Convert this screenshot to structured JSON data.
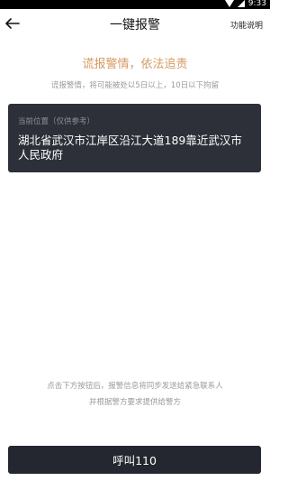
{
  "status_bar": {
    "time": "9:33"
  },
  "header": {
    "title": "一键报警",
    "help_label": "功能说明"
  },
  "warning": {
    "title": "谎报警情，依法追责",
    "subtitle": "谎报警情，将可能被处以5日以上，10日以下拘留"
  },
  "location": {
    "label": "当前位置（仅供参考）",
    "address": "湖北省武汉市江岸区沿江大道189靠近武汉市人民政府"
  },
  "notice": {
    "line1": "点击下方按钮后，报警信息将同步发送给紧急联系人",
    "line2": "并根据警方要求提供给警方"
  },
  "call_button": {
    "label": "呼叫110"
  },
  "colors": {
    "warning_title": "#d69a63",
    "card_bg": "#2d3039",
    "button_bg": "#24272f"
  }
}
